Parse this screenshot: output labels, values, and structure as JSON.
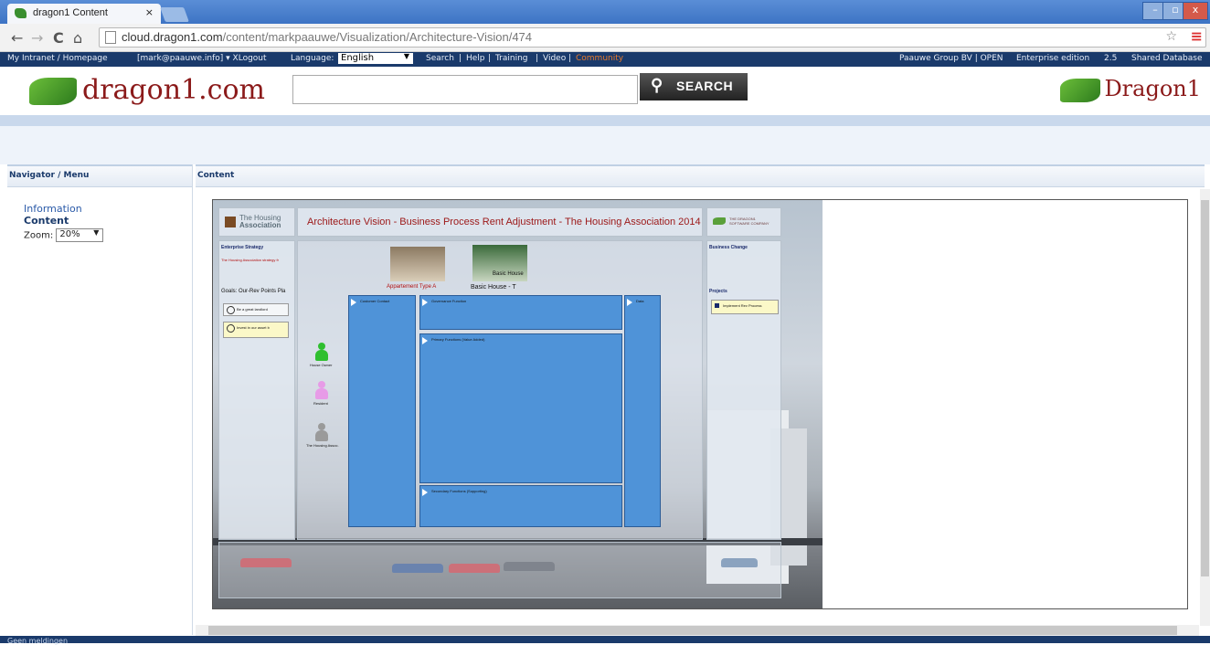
{
  "browser": {
    "tab_title": "dragon1 Content",
    "tab_close": "×",
    "url_host": "cloud.dragon1.com",
    "url_path": "/content/markpaauwe/Visualization/Architecture-Vision/474"
  },
  "topbar": {
    "intranet": "My Intranet / Homepage",
    "user": "[mark@paauwe.info] ▾ XLogout",
    "language_label": "Language:",
    "language_value": "English",
    "search": "Search",
    "help": "Help",
    "training": "Training",
    "video": "Video",
    "community": "Community",
    "sep": "|",
    "org": "Paauwe Group BV | OPEN",
    "edition": "Enterprise edition",
    "version": "2.5",
    "db": "Shared Database"
  },
  "header": {
    "logo_left": "dragon1.com",
    "search_button": "SEARCH",
    "search_value": "",
    "logo_right": "Dragon1"
  },
  "left_panel": {
    "title": "Navigator / Menu",
    "links": [
      "Information",
      "Content"
    ],
    "zoom_label": "Zoom:",
    "zoom_value": "20%"
  },
  "content_panel": {
    "title": "Content"
  },
  "viz": {
    "association_logo_l1": "The Housing",
    "association_logo_l2": "Association",
    "title": "Architecture Vision - Business Process Rent Adjustment - The Housing Association 2014",
    "vendor_logo_l1": "THE DRAGON1",
    "vendor_logo_l2": "SOFTWARE COMPANY",
    "enterprise_strategy": "Enterprise Strategy",
    "strategy_red": "The Housing Association strategy fr",
    "goals": "Goals: Our-Rev Points Pla",
    "goal_1": "Be a great landlord",
    "goal_2": "Invest in our asset b",
    "product_1": "Appartement Type A",
    "product_2_overlay": "Basic House",
    "product_2": "Basic House - T",
    "customer_contact": "Customer Contact",
    "governance": "Governance Function",
    "primary": "Primary Functions (Value Added)",
    "secondary": "Secondary Functions (Supporting)",
    "data": "Data",
    "actor_1": "House Owner",
    "actor_2": "Resident",
    "actor_3": "The Housing Assoc.",
    "business_change": "Business Change",
    "projects": "Projects",
    "project_1": "Implement Rev Process",
    "colors": {
      "blue": "#4f93d8",
      "actor_1": "#2fbf2f",
      "actor_2": "#e79be7",
      "actor_3": "#9a9a9a"
    }
  },
  "status": {
    "text": "Geen meldingen"
  }
}
